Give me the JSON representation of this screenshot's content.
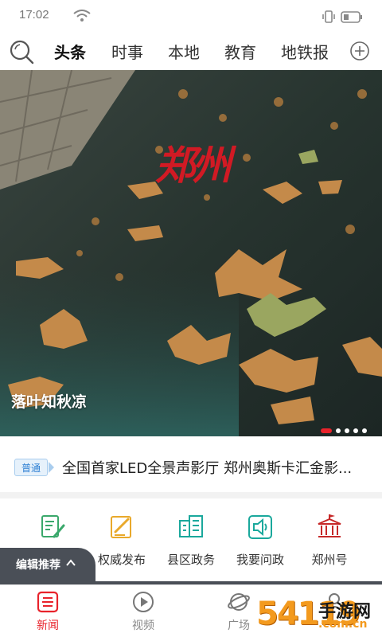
{
  "status_bar": {
    "time": "17:02"
  },
  "nav": {
    "tabs": [
      {
        "label": "头条",
        "active": true
      },
      {
        "label": "时事",
        "active": false
      },
      {
        "label": "本地",
        "active": false
      },
      {
        "label": "教育",
        "active": false
      },
      {
        "label": "地铁报",
        "active": false
      }
    ]
  },
  "hero": {
    "logo_text": "郑州",
    "caption": "落叶知秋凉",
    "slide_count": 5,
    "active_slide": 1
  },
  "ticker": {
    "badge": "普通",
    "headline": "全国首家LED全景声影厅 郑州奥斯卡汇金影..."
  },
  "services": [
    {
      "label": "编辑推荐",
      "icon": "edit-recommend-icon"
    },
    {
      "label": "权威发布",
      "icon": "authority-publish-icon"
    },
    {
      "label": "县区政务",
      "icon": "county-affairs-icon"
    },
    {
      "label": "我要问政",
      "icon": "ask-government-icon"
    },
    {
      "label": "郑州号",
      "icon": "zhengzhou-account-icon"
    }
  ],
  "editor_recommend": {
    "label": "编辑推荐"
  },
  "bottom_nav": [
    {
      "label": "新闻",
      "active": true
    },
    {
      "label": "视频",
      "active": false
    },
    {
      "label": "广场",
      "active": false
    },
    {
      "label": "",
      "active": false
    }
  ],
  "watermark": {
    "number": "54119",
    "cn": "手游网",
    "url": ".com.cn"
  },
  "colors": {
    "accent": "#e8232b",
    "icon_green": "#3aa86b",
    "icon_yellow": "#e9a92b",
    "icon_teal": "#1aa89c",
    "icon_red": "#c62828"
  }
}
